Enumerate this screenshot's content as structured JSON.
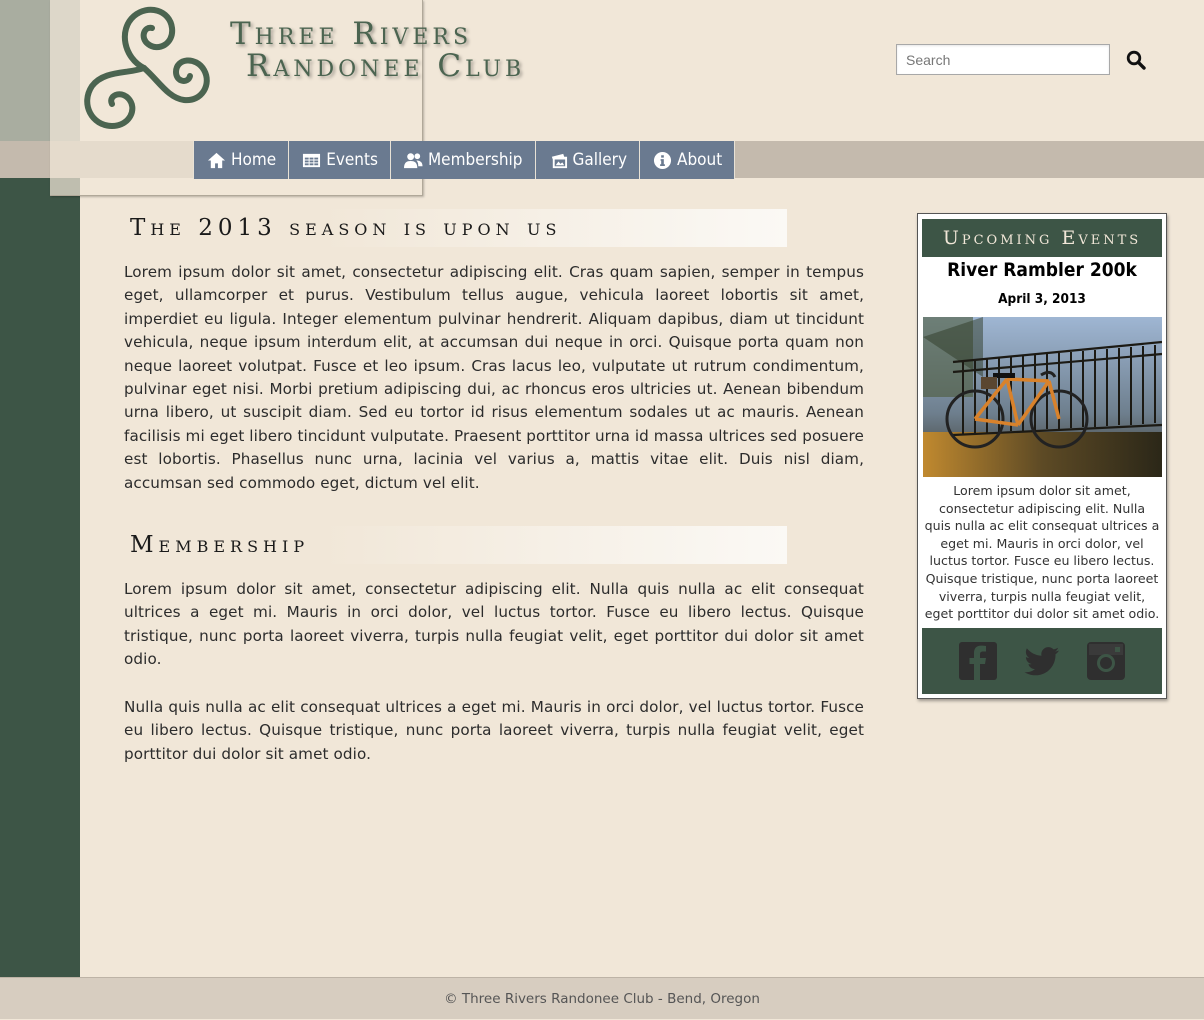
{
  "site": {
    "title_line1": "Three Rivers",
    "title_line2": "Randonee Club"
  },
  "search": {
    "placeholder": "Search"
  },
  "nav": {
    "items": [
      {
        "label": "Home",
        "icon": "home-icon"
      },
      {
        "label": "Events",
        "icon": "calendar-icon"
      },
      {
        "label": "Membership",
        "icon": "users-icon"
      },
      {
        "label": "Gallery",
        "icon": "photos-icon"
      },
      {
        "label": "About",
        "icon": "info-icon"
      }
    ]
  },
  "main": {
    "sections": [
      {
        "title": "The 2013 season is upon us",
        "paragraphs": [
          "Lorem ipsum dolor sit amet, consectetur adipiscing elit. Cras quam sapien, semper in tempus eget, ullamcorper et purus. Vestibulum tellus augue, vehicula laoreet lobortis sit amet, imperdiet eu ligula. Integer elementum pulvinar hendrerit. Aliquam dapibus, diam ut tincidunt vehicula, neque ipsum interdum elit, at accumsan dui neque in orci. Quisque porta quam non neque laoreet volutpat. Fusce et leo ipsum. Cras lacus leo, vulputate ut rutrum condimentum, pulvinar eget nisi. Morbi pretium adipiscing dui, ac rhoncus eros ultricies ut. Aenean bibendum urna libero, ut suscipit diam. Sed eu tortor id risus elementum sodales ut ac mauris. Aenean facilisis mi eget libero tincidunt vulputate. Praesent porttitor urna id massa ultrices sed posuere est lobortis. Phasellus nunc urna, lacinia vel varius a, mattis vitae elit. Duis nisl diam, accumsan sed commodo eget, dictum vel elit."
        ]
      },
      {
        "title": "Membership",
        "paragraphs": [
          "Lorem ipsum dolor sit amet, consectetur adipiscing elit. Nulla quis nulla ac elit consequat ultrices a eget mi. Mauris in orci dolor, vel luctus tortor. Fusce eu libero lectus. Quisque tristique, nunc porta laoreet viverra, turpis nulla feugiat velit, eget porttitor dui dolor sit amet odio.",
          "Nulla quis nulla ac elit consequat ultrices a eget mi. Mauris in orci dolor, vel luctus tortor. Fusce eu libero lectus. Quisque tristique, nunc porta laoreet viverra, turpis nulla feugiat velit, eget porttitor dui dolor sit amet odio."
        ]
      }
    ]
  },
  "sidebar": {
    "header": "Upcoming Events",
    "event_title": "River Rambler 200k",
    "event_date": "April 3, 2013",
    "event_text": "Lorem ipsum dolor sit amet, consectetur adipiscing elit. Nulla quis nulla ac elit consequat ultrices a eget mi. Mauris in orci dolor, vel luctus tortor. Fusce eu libero lectus. Quisque tristique, nunc porta laoreet viverra, turpis nulla feugiat velit, eget porttitor dui dolor sit amet odio.",
    "social": [
      "facebook-icon",
      "twitter-icon",
      "instagram-icon"
    ]
  },
  "footer": {
    "text": "© Three Rivers Randonee Club - Bend, Oregon"
  },
  "colors": {
    "background": "#f1e7d8",
    "dark_green": "#3d5546",
    "nav_button": "#6a7a90",
    "logo_green": "#4b6450"
  }
}
